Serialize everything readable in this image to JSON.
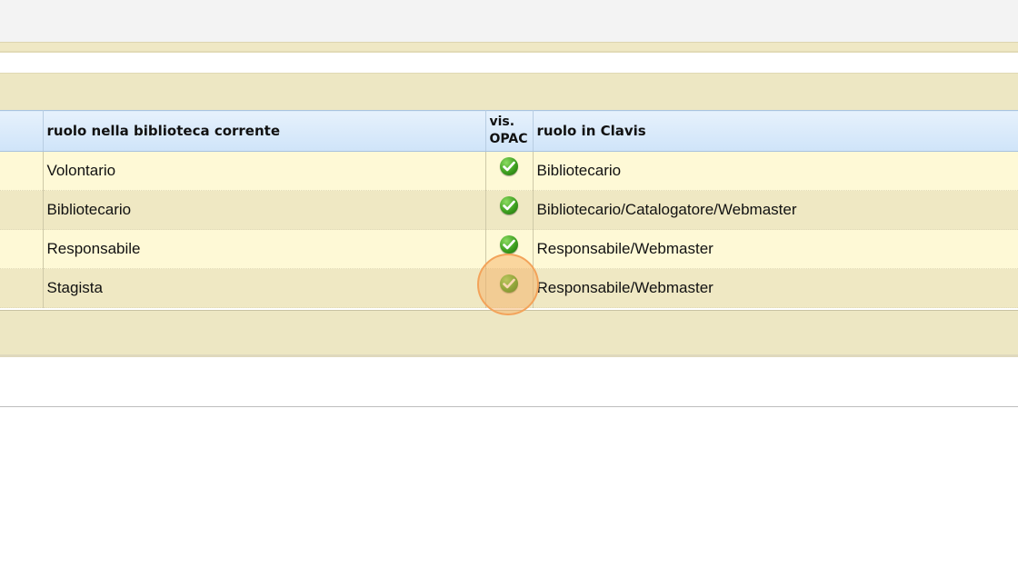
{
  "table": {
    "headers": {
      "role_current": "ruolo nella biblioteca corrente",
      "opac_line1": "vis.",
      "opac_line2": "OPAC",
      "role_clavis": "ruolo in Clavis"
    },
    "rows": [
      {
        "role_current": "Volontario",
        "opac_visible": true,
        "role_clavis": "Bibliotecario"
      },
      {
        "role_current": "Bibliotecario",
        "opac_visible": true,
        "role_clavis": "Bibliotecario/Catalogatore/Webmaster"
      },
      {
        "role_current": "Responsabile",
        "opac_visible": true,
        "role_clavis": "Responsabile/Webmaster"
      },
      {
        "role_current": "Stagista",
        "opac_visible": true,
        "role_clavis": "Responsabile/Webmaster"
      }
    ]
  },
  "colors": {
    "header_blue": "#cfe4f9",
    "row_light": "#fef9d6",
    "row_dark": "#efe8c3",
    "check_green": "#3ea01f",
    "click_marker": "#f3a35a"
  },
  "icons": {
    "opac_check": "check-circle-icon"
  }
}
